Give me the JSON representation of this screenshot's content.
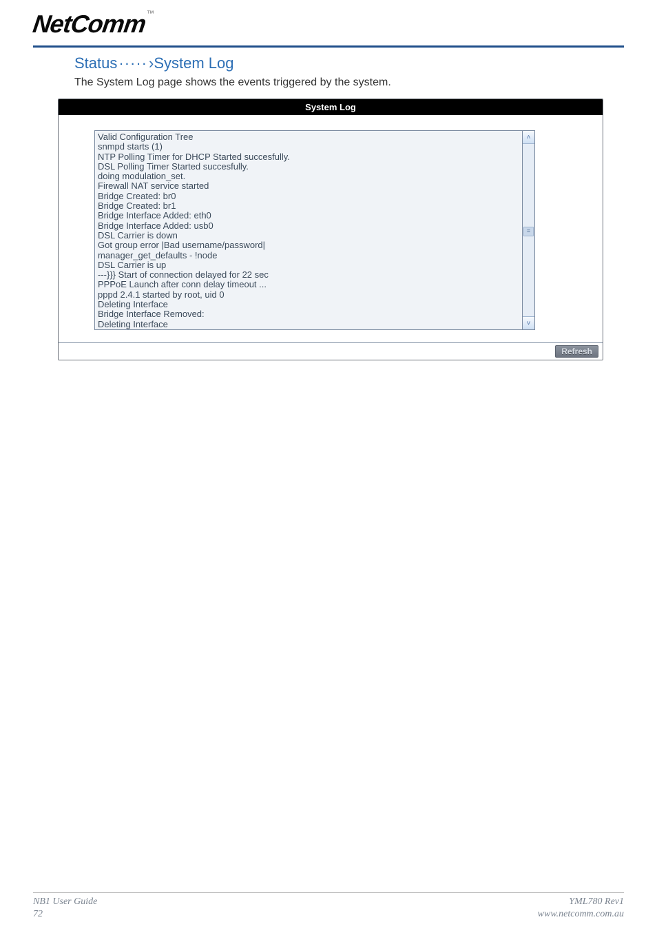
{
  "brand": {
    "name": "NetComm",
    "tm": "™"
  },
  "breadcrumb": {
    "lead": "Status",
    "dots": "·····",
    "arrow": "›",
    "tail": "System Log"
  },
  "intro": "The System Log page shows the events triggered by the system.",
  "panel": {
    "title": "System Log",
    "refresh_label": "Refresh",
    "log_lines": [
      "Valid Configuration Tree",
      "snmpd starts (1)",
      "NTP Polling Timer for DHCP Started succesfully.",
      "DSL Polling Timer Started succesfully.",
      "doing modulation_set.",
      "Firewall NAT service started",
      "Bridge Created: br0",
      "Bridge Created: br1",
      "Bridge Interface Added: eth0",
      "Bridge Interface Added: usb0",
      "DSL Carrier is down",
      "Got group error |Bad username/password|",
      "manager_get_defaults - !node",
      "DSL Carrier is up",
      "---}}} Start of connection delayed for 22 sec",
      "PPPoE Launch after conn delay timeout ...",
      "pppd 2.4.1 started by root, uid 0",
      "Deleting Interface",
      "Bridge Interface Removed:",
      "Deleting Interface"
    ]
  },
  "footer": {
    "left_line1": "NB1 User Guide",
    "left_line2": "72",
    "right_line1": "YML780 Rev1",
    "right_line2": "www.netcomm.com.au"
  },
  "icons": {
    "scroll_up": "˄",
    "scroll_down": "˅",
    "scroll_grip": "≡"
  }
}
